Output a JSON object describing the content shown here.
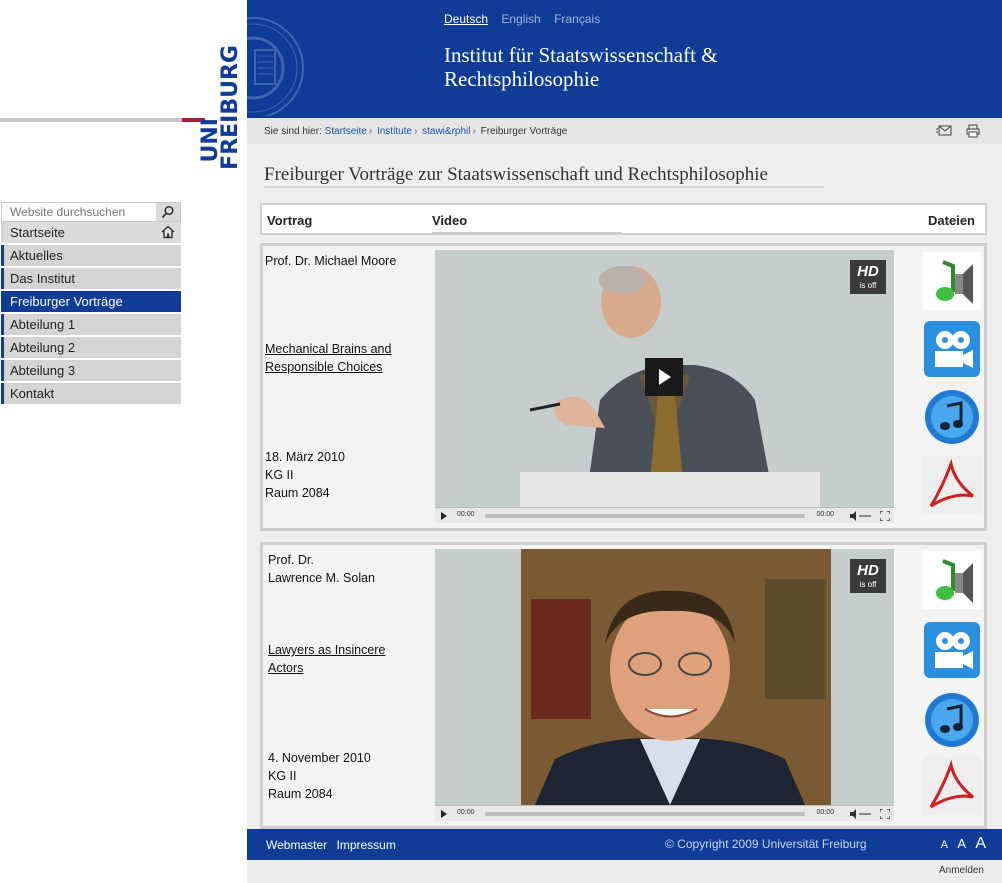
{
  "languages": [
    {
      "label": "Deutsch",
      "current": true
    },
    {
      "label": "English",
      "current": false
    },
    {
      "label": "Français",
      "current": false
    }
  ],
  "site_title_line1": "Institut für Staatswissenschaft &",
  "site_title_line2": "Rechtsphilosophie",
  "logo": {
    "line1": "UNI",
    "line2": "FREIBURG"
  },
  "search": {
    "placeholder": "Website durchsuchen"
  },
  "nav": [
    {
      "label": "Startseite"
    },
    {
      "label": "Aktuelles"
    },
    {
      "label": "Das Institut"
    },
    {
      "label": "Freiburger Vorträge"
    },
    {
      "label": "Abteilung 1"
    },
    {
      "label": "Abteilung 2"
    },
    {
      "label": "Abteilung 3"
    },
    {
      "label": "Kontakt"
    }
  ],
  "breadcrumb": {
    "prefix": "Sie sind hier:",
    "items": [
      "Startseite",
      "Institute",
      "stawi&rphil"
    ],
    "current": "Freiburger Vorträge"
  },
  "page_title": "Freiburger Vorträge zur Staatswissenschaft und Rechtsphilosophie",
  "table_head": {
    "col1": "Vortrag",
    "col2": "Video",
    "col3": "Dateien"
  },
  "lectures": [
    {
      "speaker": "Prof. Dr. Michael Moore",
      "title_line1": "Mechanical Brains and",
      "title_line2": "Responsible Choices",
      "date": "18. März 2010",
      "building": "KG II",
      "room": "Raum 2084",
      "time_current": "00:00",
      "time_total": "00:00"
    },
    {
      "speaker_line1": "Prof. Dr.",
      "speaker_line2": "Lawrence M. Solan",
      "title_line1": "Lawyers as Insincere",
      "title_line2": "Actors",
      "date": "4. November 2010",
      "building": "KG II",
      "room": "Raum 2084",
      "time_current": "00:00",
      "time_total": "00:00"
    }
  ],
  "hd": {
    "label": "HD",
    "sub": "is off"
  },
  "footer": {
    "webmaster": "Webmaster",
    "impressum": "Impressum",
    "copyright": "© Copyright 2009 Universität Freiburg",
    "font_small": "A",
    "font_medium": "A",
    "font_large": "A",
    "login": "Anmelden"
  },
  "colors": {
    "brand_blue": "#0e3c97",
    "brand_red": "#a51e36"
  }
}
